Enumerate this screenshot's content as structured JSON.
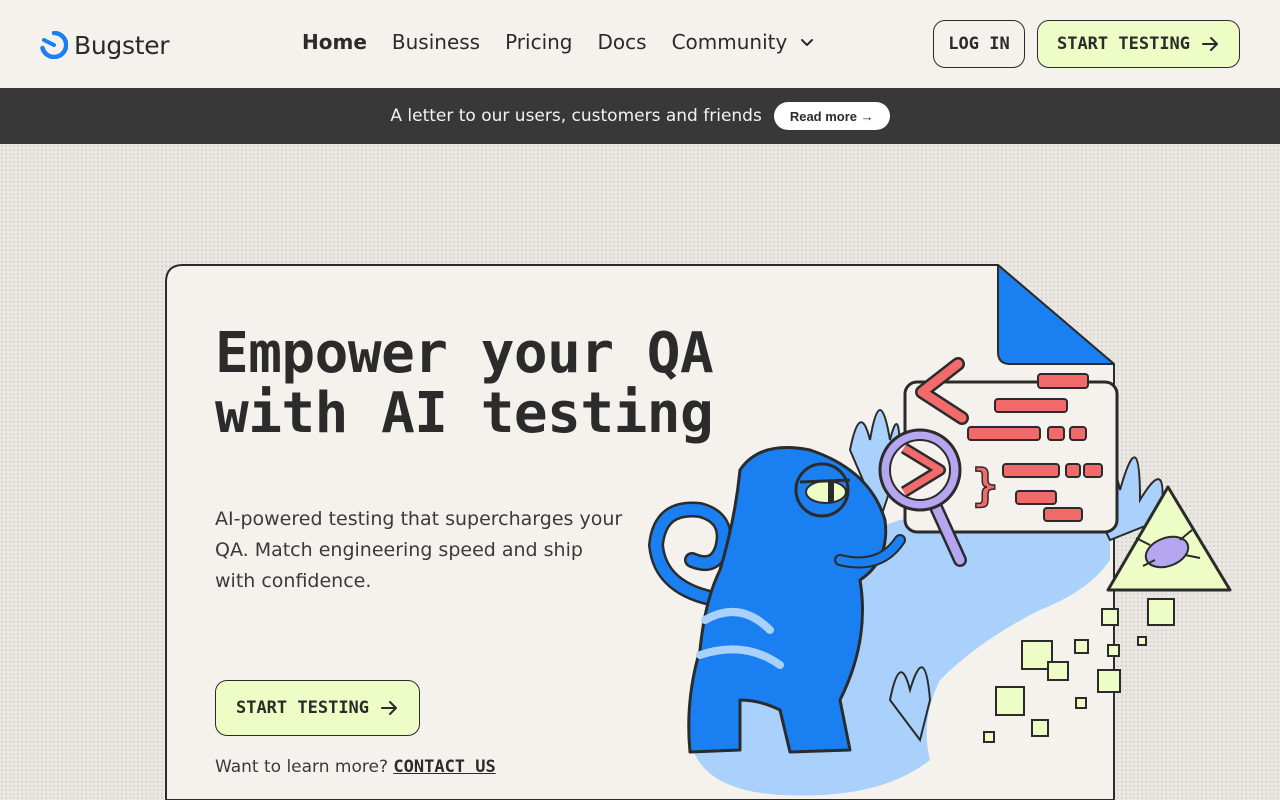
{
  "header": {
    "logo_text": "Bugster",
    "nav": [
      {
        "label": "Home",
        "active": true
      },
      {
        "label": "Business"
      },
      {
        "label": "Pricing"
      },
      {
        "label": "Docs"
      },
      {
        "label": "Community",
        "has_dropdown": true
      }
    ],
    "login_label": "LOG IN",
    "start_label": "START TESTING"
  },
  "banner": {
    "text": "A letter to our users, customers and friends",
    "button_label": "Read more →"
  },
  "hero": {
    "title_line1": "Empower your QA",
    "title_line2": "with AI testing",
    "subtitle": "AI-powered testing that supercharges your QA. Match engineering speed and ship with confidence.",
    "cta_label": "START TESTING",
    "learn_prefix": "Want to learn more?",
    "contact_label": "CONTACT US"
  },
  "colors": {
    "brand_blue": "#1a7ff0",
    "accent_lime": "#eefcc5",
    "banner_bg": "#383838",
    "card_bg": "#f5f2ee",
    "code_red": "#f26a6a"
  },
  "icons": [
    "logo-mark-icon",
    "chevron-down-icon",
    "arrow-right-icon"
  ]
}
